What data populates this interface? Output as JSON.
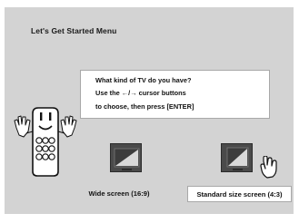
{
  "menu": {
    "title": "Let's Get Started Menu"
  },
  "prompt": {
    "line1": "What kind of TV do you have?",
    "line2": "Use the ←/→ cursor buttons",
    "line3": "to choose, then press [ENTER]"
  },
  "options": [
    {
      "label": "Wide screen (16:9)",
      "icon": "wide-tv-icon",
      "selected": false
    },
    {
      "label": "Standard size screen (4:3)",
      "icon": "standard-tv-icon",
      "selected": true
    }
  ],
  "mascot": {
    "icon": "remote-control-mascot-icon"
  },
  "cursor": {
    "icon": "pointing-hand-icon"
  },
  "colors": {
    "panel_background": "#d3d3d3",
    "box_background": "#ffffff",
    "box_border": "#a8a8a8",
    "tv_body": "#4a4a4a",
    "text": "#111111"
  }
}
